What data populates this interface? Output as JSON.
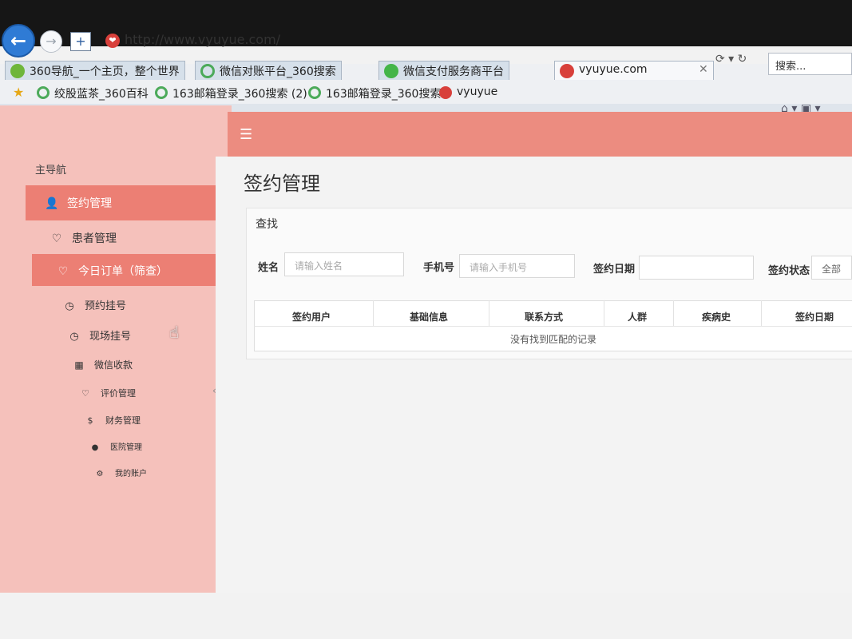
{
  "browser": {
    "url": "http://www.vyuyue.com/",
    "search_placeholder": "搜索...",
    "tabs": [
      {
        "label": "360导航_一个主页，整个世界"
      },
      {
        "label": "微信对账平台_360搜索"
      },
      {
        "label": "微信支付服务商平台"
      },
      {
        "label": "vyuyue.com"
      }
    ],
    "favorites": [
      {
        "label": "绞股蓝茶_360百科"
      },
      {
        "label": "163邮箱登录_360搜索 (2)"
      },
      {
        "label": "163邮箱登录_360搜索"
      },
      {
        "label": "vyuyue"
      }
    ]
  },
  "sidebar": {
    "heading": "主导航",
    "items": [
      {
        "label": "签约管理",
        "icon": "user-icon"
      },
      {
        "label": "患者管理",
        "icon": "heart-icon"
      },
      {
        "label": "今日订单（筛查）",
        "icon": "heart-icon"
      },
      {
        "label": "预约挂号",
        "icon": "clock-icon"
      },
      {
        "label": "现场挂号",
        "icon": "clock-icon"
      },
      {
        "label": "微信收款",
        "icon": "qrcode-icon"
      },
      {
        "label": "评价管理",
        "icon": "heart-icon"
      },
      {
        "label": "财务管理",
        "icon": "dollar-icon"
      },
      {
        "label": "医院管理",
        "icon": "circle-icon"
      },
      {
        "label": "我的账户",
        "icon": "gear-icon"
      }
    ]
  },
  "main": {
    "title": "签约管理",
    "panel_header": "查找",
    "filters": {
      "name_label": "姓名",
      "name_placeholder": "请输入姓名",
      "phone_label": "手机号",
      "phone_placeholder": "请输入手机号",
      "date_label": "签约日期",
      "status_label": "签约状态",
      "status_value": "全部"
    },
    "table": {
      "columns": [
        "签约用户",
        "基础信息",
        "联系方式",
        "人群",
        "疾病史",
        "签约日期"
      ],
      "empty_text": "没有找到匹配的记录"
    }
  }
}
